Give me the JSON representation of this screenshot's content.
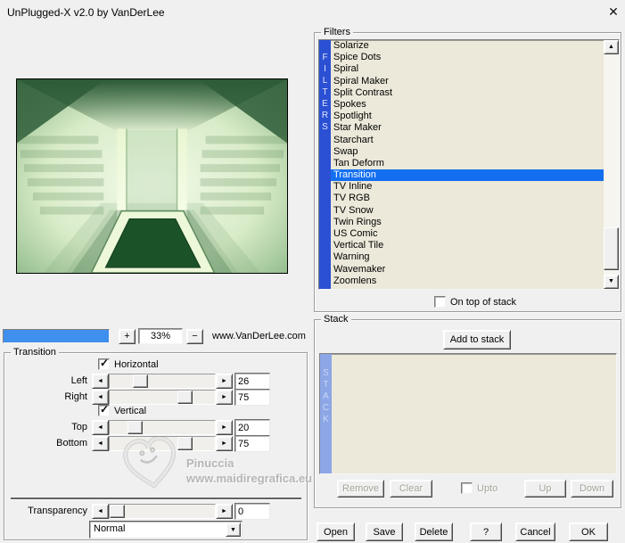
{
  "window": {
    "title": "UnPlugged-X v2.0 by VanDerLee"
  },
  "icons": {
    "close": "✕",
    "plus": "+",
    "minus": "−",
    "left_arrow": "◄",
    "right_arrow": "►",
    "up_arrow": "▲",
    "down_arrow": "▼",
    "check": "✓",
    "dropdown_arrow": "▼"
  },
  "preview": {
    "zoom_level": "33%",
    "website": "www.VanDerLee.com",
    "progress_percent": 100
  },
  "watermark": {
    "name": "Pinuccia",
    "url": "www.maidiregrafica.eu"
  },
  "transition": {
    "group_label": "Transition",
    "horizontal": {
      "label": "Horizontal",
      "checked": true
    },
    "vertical": {
      "label": "Vertical",
      "checked": true
    },
    "sliders": [
      {
        "label": "Left",
        "value": "26",
        "percent": 26
      },
      {
        "label": "Right",
        "value": "75",
        "percent": 75
      },
      {
        "label": "Top",
        "value": "20",
        "percent": 20
      },
      {
        "label": "Bottom",
        "value": "75",
        "percent": 75
      }
    ],
    "transparency": {
      "label": "Transparency",
      "value": "0",
      "percent": 0
    },
    "blend_mode": {
      "value": "Normal"
    }
  },
  "filters": {
    "group_label": "Filters",
    "side_label": "FILTERS",
    "items": [
      "Solarize",
      "Spice Dots",
      "Spiral",
      "Spiral Maker",
      "Split Contrast",
      "Spokes",
      "Spotlight",
      "Star Maker",
      "Starchart",
      "Swap",
      "Tan Deform",
      "Transition",
      "TV Inline",
      "TV RGB",
      "TV Snow",
      "Twin Rings",
      "US Comic",
      "Vertical Tile",
      "Warning",
      "Wavemaker",
      "Zoomlens"
    ],
    "selected": "Transition",
    "on_top": {
      "label": "On top of stack",
      "checked": false
    }
  },
  "stack": {
    "group_label": "Stack",
    "side_label": "STACK",
    "add_button": "Add to stack",
    "remove_button": "Remove",
    "clear_button": "Clear",
    "upto": {
      "label": "Upto",
      "checked": false
    },
    "up_button": "Up",
    "down_button": "Down"
  },
  "actions": {
    "open": "Open",
    "save": "Save",
    "delete": "Delete",
    "help": "?",
    "cancel": "Cancel",
    "ok": "OK"
  },
  "colors": {
    "filters_bar": "#2b50d4",
    "stack_bar": "#8da7e6",
    "selection": "#146ff0",
    "progress": "#3f8fef",
    "list_bg": "#ece9da"
  }
}
